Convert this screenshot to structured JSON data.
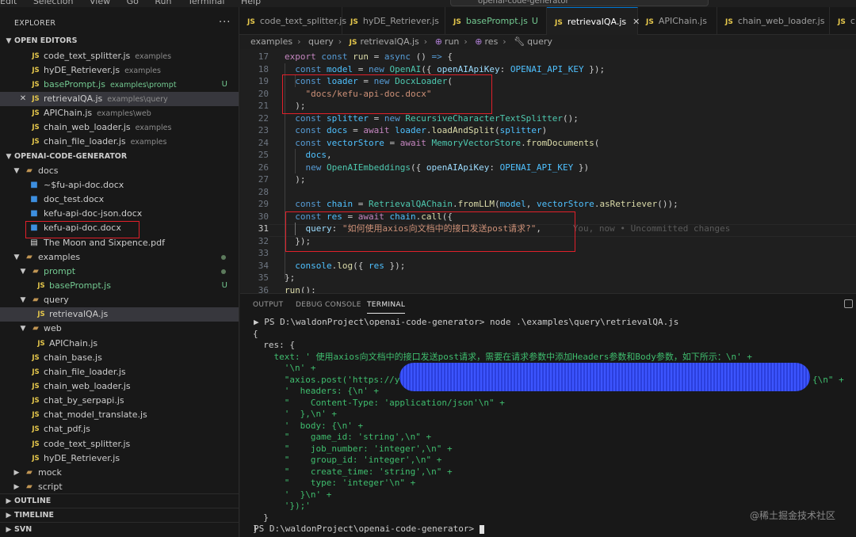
{
  "titlebar": {
    "menus": [
      "Edit",
      "Selection",
      "View",
      "Go",
      "Run",
      "Terminal",
      "Help"
    ],
    "command_center": "openai-code-generator"
  },
  "sidebar": {
    "title": "EXPLORER",
    "open_editors_label": "OPEN EDITORS",
    "open_editors": [
      {
        "name": "code_text_splitter.js",
        "desc": "examples",
        "status": ""
      },
      {
        "name": "hyDE_Retriever.js",
        "desc": "examples",
        "status": ""
      },
      {
        "name": "basePrompt.js",
        "desc": "examples\\prompt",
        "status": "U"
      },
      {
        "name": "retrievalQA.js",
        "desc": "examples\\query",
        "status": ""
      },
      {
        "name": "APIChain.js",
        "desc": "examples\\web",
        "status": ""
      },
      {
        "name": "chain_web_loader.js",
        "desc": "examples",
        "status": ""
      },
      {
        "name": "chain_file_loader.js",
        "desc": "examples",
        "status": ""
      }
    ],
    "project_label": "OPENAI-CODE-GENERATOR",
    "tree": {
      "docs": "docs",
      "docs_files": [
        "~$fu-api-doc.docx",
        "doc_test.docx",
        "kefu-api-doc-json.docx",
        "kefu-api-doc.docx",
        "The Moon and Sixpence.pdf"
      ],
      "examples": "examples",
      "prompt": "prompt",
      "prompt_file": "basePrompt.js",
      "prompt_file_status": "U",
      "query": "query",
      "query_file": "retrievalQA.js",
      "web": "web",
      "web_file": "APIChain.js",
      "example_files": [
        "chain_base.js",
        "chain_file_loader.js",
        "chain_web_loader.js",
        "chat_by_serpapi.js",
        "chat_model_translate.js",
        "chat_pdf.js",
        "code_text_splitter.js",
        "hyDE_Retriever.js"
      ],
      "mock": "mock",
      "script": "script"
    },
    "bottom_sections": [
      "OUTLINE",
      "TIMELINE",
      "SVN"
    ]
  },
  "tabs": [
    {
      "label": "code_text_splitter.js",
      "badge": ""
    },
    {
      "label": "hyDE_Retriever.js",
      "badge": ""
    },
    {
      "label": "basePrompt.js",
      "badge": "U"
    },
    {
      "label": "retrievalQA.js",
      "badge": "",
      "active": true
    },
    {
      "label": "APIChain.js",
      "badge": ""
    },
    {
      "label": "chain_web_loader.js",
      "badge": ""
    },
    {
      "label": "c",
      "badge": ""
    }
  ],
  "breadcrumb": [
    "examples",
    "query",
    "retrievalQA.js",
    "run",
    "res",
    "query"
  ],
  "editor": {
    "line_numbers": [
      "17",
      "18",
      "19",
      "20",
      "21",
      "22",
      "23",
      "24",
      "25",
      "26",
      "27",
      "28",
      "29",
      "30",
      "31",
      "32",
      "33",
      "34",
      "35",
      "36"
    ],
    "current_line": "31",
    "blame": "You, now • Uncommitted changes"
  },
  "panel": {
    "tabs": [
      "OUTPUT",
      "DEBUG CONSOLE",
      "TERMINAL"
    ],
    "prompt_line": "PS D:\\waldonProject\\openai-code-generator> node .\\examples\\query\\retrievalQA.js",
    "lines": [
      "{",
      "  res: {",
      "    text: ' 使用axios向文档中的接口发送post请求，需要在请求参数中添加Headers参数和Body参数，如下所示：\\n' +",
      "      '\\n' +",
      "      \"axios.post('https://yap",
      "      '  headers: {\\n' +",
      "      \"    Content-Type: 'application/json'\\n\" +",
      "      '  },\\n' +",
      "      '  body: {\\n' +",
      "      \"    game_id: 'string',\\n\" +",
      "      \"    job_number: 'integer',\\n\" +",
      "      \"    group_id: 'integer',\\n\" +",
      "      \"    create_time: 'string',\\n\" +",
      "      \"    type: 'integer'\\n\" +",
      "      '  }\\n' +",
      "      '});'",
      "  }",
      "}"
    ],
    "line4_tail": "{\\n\" +",
    "final_prompt": "PS D:\\waldonProject\\openai-code-generator> "
  },
  "watermark": "@稀土掘金技术社区",
  "colors": {
    "accent": "#0078d4",
    "highlight_box": "#e0202a",
    "scribble": "#3c55ff"
  }
}
